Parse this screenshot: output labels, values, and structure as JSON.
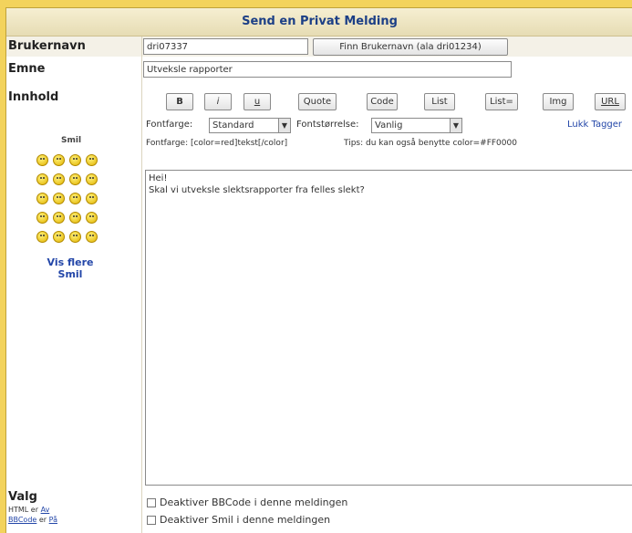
{
  "title": "Send en Privat Melding",
  "username": {
    "label": "Brukernavn",
    "value": "dri07337",
    "find_button": "Finn Brukernavn (ala dri01234)"
  },
  "subject": {
    "label": "Emne",
    "value": "Utveksle rapporter"
  },
  "content": {
    "label": "Innhold",
    "smilies_title": "Smil",
    "more_smilies": "Vis flere Smil",
    "toolbar": [
      "B",
      "i",
      "u",
      "Quote",
      "Code",
      "List",
      "List=",
      "Img",
      "URL"
    ],
    "font_color_label": "Fontfarge:",
    "font_color_value": "Standard",
    "font_size_label": "Fontstørrelse:",
    "font_size_value": "Vanlig",
    "close_tags": "Lukk Tagger",
    "hint": "Fontfarge: [color=red]tekst[/color]",
    "tip": "Tips: du kan også benytte color=#FF0000",
    "message_lines": [
      "Hei!",
      "Skal vi utveksle slektsrapporter fra felles slekt?"
    ]
  },
  "options": {
    "label": "Valg",
    "html_status_prefix": "HTML er",
    "html_status_value": "Av",
    "bbcode_link": "BBCode",
    "bbcode_status_prefix": "er",
    "bbcode_status_value": "På",
    "checkboxes": [
      "Deaktiver BBCode i denne meldingen",
      "Deaktiver Smil i denne meldingen"
    ]
  }
}
